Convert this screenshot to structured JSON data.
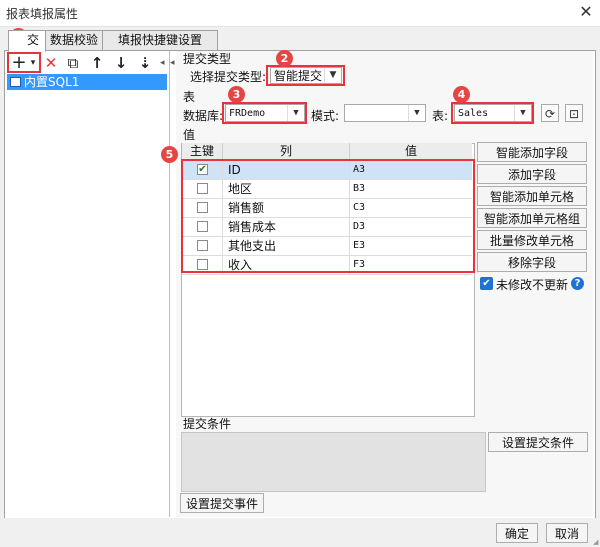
{
  "window": {
    "title": "报表填报属性",
    "close_glyph": "✕"
  },
  "tabs": [
    {
      "label": "提交",
      "shown": "交"
    },
    {
      "label": "数据校验"
    },
    {
      "label": "填报快捷键设置"
    }
  ],
  "toolbar": {
    "add": "+",
    "add_arrow": "▾",
    "delete": "✕",
    "copy": "⧉",
    "up": "↑",
    "down": "↓",
    "sort": "⇣"
  },
  "list": {
    "items": [
      {
        "label": "内置SQL1"
      }
    ]
  },
  "submit_type": {
    "section": "提交类型",
    "label": "选择提交类型:",
    "value": "智能提交"
  },
  "table_section": {
    "section": "表",
    "db_label": "数据库:",
    "db_value": "FRDemo",
    "mode_label": "模式:",
    "mode_value": "",
    "table_label": "表:",
    "table_value": "Sales"
  },
  "values_section": {
    "section": "值",
    "columns": [
      "主键",
      "列",
      "值"
    ],
    "rows": [
      {
        "key": true,
        "col": "ID",
        "val": "A3"
      },
      {
        "key": false,
        "col": "地区",
        "val": "B3"
      },
      {
        "key": false,
        "col": "销售额",
        "val": "C3"
      },
      {
        "key": false,
        "col": "销售成本",
        "val": "D3"
      },
      {
        "key": false,
        "col": "其他支出",
        "val": "E3"
      },
      {
        "key": false,
        "col": "收入",
        "val": "F3"
      }
    ]
  },
  "side_buttons": [
    "智能添加字段",
    "添加字段",
    "智能添加单元格",
    "智能添加单元格组",
    "批量修改单元格",
    "移除字段"
  ],
  "no_update_checkbox": {
    "label": "未修改不更新",
    "checked": true
  },
  "help_glyph": "?",
  "condition": {
    "section": "提交条件",
    "button": "设置提交条件"
  },
  "event_button": "设置提交事件",
  "footer": {
    "ok": "确定",
    "cancel": "取消"
  },
  "badges": [
    "1",
    "2",
    "3",
    "4",
    "5"
  ],
  "accent_color": "#e8333c",
  "selection_color": "#3399ff"
}
